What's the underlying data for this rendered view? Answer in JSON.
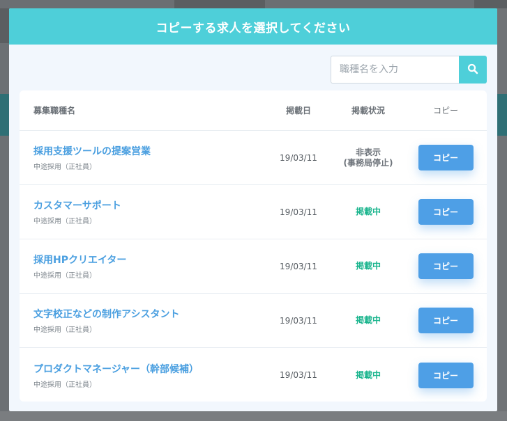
{
  "modal": {
    "title": "コピーする求人を選択してください"
  },
  "search": {
    "placeholder": "職種名を入力"
  },
  "table": {
    "headers": {
      "title": "募集職種名",
      "date": "掲載日",
      "status": "掲載状況",
      "copy": "コピー"
    },
    "rows": [
      {
        "title": "採用支援ツールの提案営業",
        "type": "中途採用（正社員）",
        "date": "19/03/11",
        "status_line1": "非表示",
        "status_line2": "(事務局停止)",
        "status_kind": "hidden",
        "copy_label": "コピー"
      },
      {
        "title": "カスタマーサポート",
        "type": "中途採用（正社員）",
        "date": "19/03/11",
        "status_line1": "掲載中",
        "status_line2": "",
        "status_kind": "live",
        "copy_label": "コピー"
      },
      {
        "title": "採用HPクリエイター",
        "type": "中途採用（正社員）",
        "date": "19/03/11",
        "status_line1": "掲載中",
        "status_line2": "",
        "status_kind": "live",
        "copy_label": "コピー"
      },
      {
        "title": "文字校正などの制作アシスタント",
        "type": "中途採用（正社員）",
        "date": "19/03/11",
        "status_line1": "掲載中",
        "status_line2": "",
        "status_kind": "live",
        "copy_label": "コピー"
      },
      {
        "title": "プロダクトマネージャー（幹部候補）",
        "type": "中途採用（正社員）",
        "date": "19/03/11",
        "status_line1": "掲載中",
        "status_line2": "",
        "status_kind": "live",
        "copy_label": "コピー"
      }
    ]
  },
  "colors": {
    "accent": "#4ecfd9",
    "link": "#4a9fe0",
    "button": "#4e9fe6",
    "live_status": "#1bb58e"
  },
  "icons": {
    "search": "search-icon"
  }
}
